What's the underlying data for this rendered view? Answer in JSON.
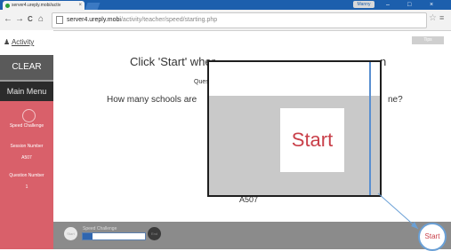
{
  "browser": {
    "tab_title": "server4.ureply.mobi/activ",
    "tab_close": "×",
    "user_badge": "Manny",
    "url_host": "server4.ureply.mobi",
    "url_path": "/activity/teacher/speed/starting.php",
    "nav_back": "←",
    "nav_forward": "→",
    "nav_reload": "C",
    "nav_home": "⌂",
    "star": "☆",
    "menu": "≡",
    "win_minimize": "–",
    "win_maximize": "□",
    "win_close": "×"
  },
  "sidebar": {
    "activity_label": "Activity",
    "clear_label": "CLEAR",
    "main_menu_label": "Main Menu",
    "speed_label": "Speed Challenge",
    "session_label": "Session Number",
    "session_number": "A507",
    "question_label": "Question Number",
    "question_number": "1"
  },
  "main": {
    "top_right_tab": "Tips",
    "instruction": "Click 'Start' wher",
    "instruction_tail": "n",
    "question_label_partial": "Ques",
    "question_text": "How many schools are",
    "question_tail": "ne?",
    "session_code": "A507"
  },
  "zoom": {
    "start_label": "Start"
  },
  "bottom": {
    "start_mini": "Start",
    "progress_label": "Speed Challenge",
    "progress_fraction": 0.15,
    "end_mini": "End",
    "start_button": "Start"
  },
  "colors": {
    "chrome_blue": "#1c5fad",
    "sidebar_red": "#d9606a",
    "start_red": "#c9404a",
    "highlight_blue": "#6aa0d6"
  }
}
